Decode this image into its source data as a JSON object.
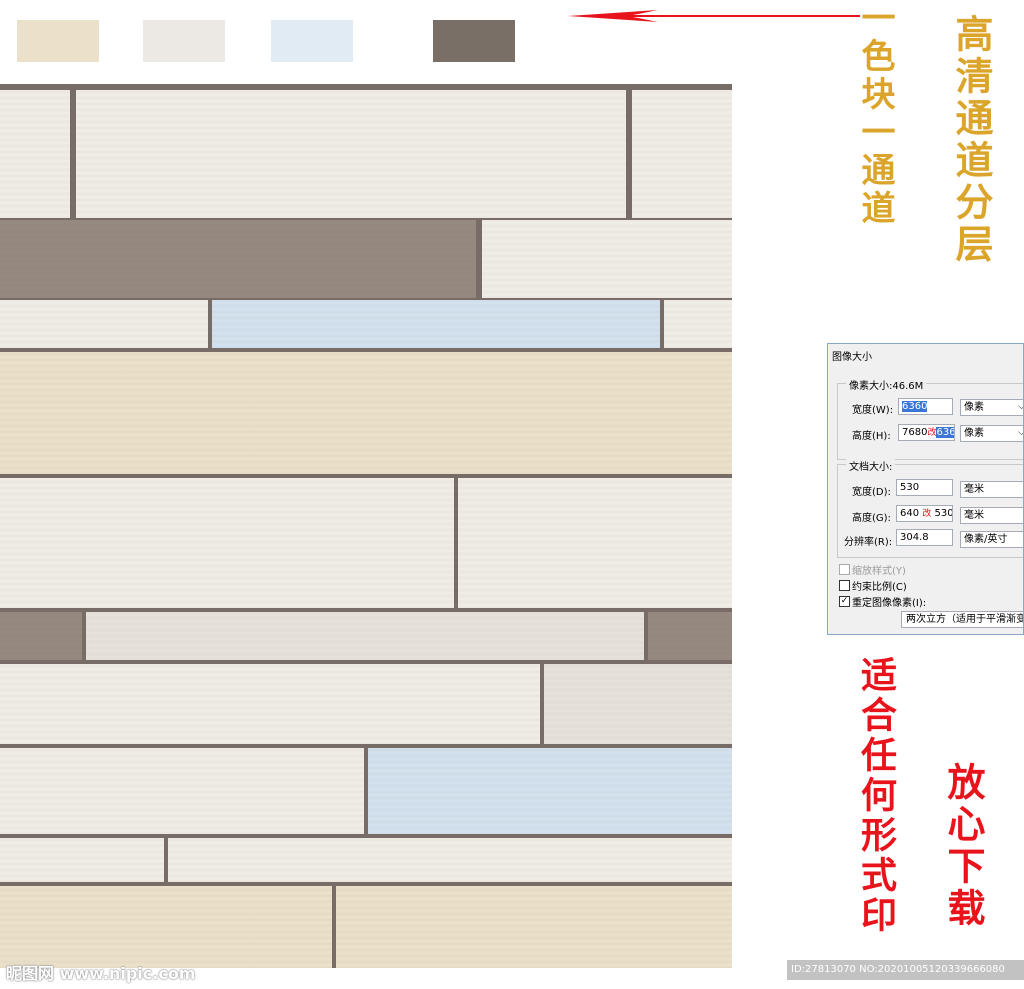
{
  "swatches": [
    {
      "color": "#ebe1cb"
    },
    {
      "color": "#ece9e4"
    },
    {
      "color": "#e1ebf4"
    },
    {
      "color": "#7a6f67"
    }
  ],
  "annotations": {
    "left_vertical": "一色块一通道",
    "right_vertical": "高清通道分层",
    "bottom_left_vertical": "适合任何形式印",
    "bottom_right_vertical": "放心下载"
  },
  "dialog": {
    "title": "图像大小",
    "pixel_size": "像素大小:46.6M",
    "width_label": "宽度(W):",
    "width_value": "6360",
    "width_unit": "像素",
    "height_label": "高度(H):",
    "height_value_old": "7680",
    "height_note": "改",
    "height_value_new": "6360",
    "height_unit": "像素",
    "doc_size": "文档大小:",
    "doc_width_label": "宽度(D):",
    "doc_width_value": "530",
    "doc_width_unit": "毫米",
    "doc_height_label": "高度(G):",
    "doc_height_value_old": "640",
    "doc_height_note": "改",
    "doc_height_value_new": "530",
    "doc_height_unit": "毫米",
    "resolution_label": "分辨率(R):",
    "resolution_value": "304.8",
    "resolution_unit": "像素/英寸",
    "scale_styles": "缩放样式(Y)",
    "constrain": "约束比例(C)",
    "resample": "重定图像像素(I):",
    "resample_method": "两次立方（适用于平滑渐变"
  },
  "watermark": "昵图网 www.nipic.com",
  "id_text": "ID:27813070 NO:20201005120339666080",
  "plank_colors": {
    "white": "#f1eee7",
    "cream": "#ece2cb",
    "grey": "#968a80",
    "blue": "#d4e2ef",
    "pale": "#e7e3dc",
    "seam": "#776c66"
  }
}
